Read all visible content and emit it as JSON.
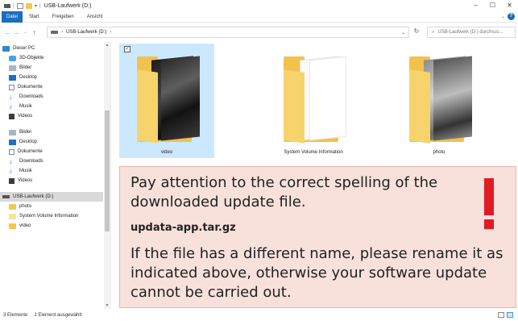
{
  "window": {
    "title": "USB-Laufwerk (D:)",
    "controls": {
      "minimize": "–",
      "maximize": "☐",
      "close": "✕"
    }
  },
  "ribbon": {
    "tabs": [
      "Datei",
      "Start",
      "Freigeben",
      "Ansicht"
    ],
    "help": "?"
  },
  "address": {
    "path": "USB-Laufwerk (D:)",
    "search_placeholder": "USB-Laufwerk (D:) durchsuc..."
  },
  "sidebar": {
    "items": [
      {
        "label": "Dieser PC",
        "icon": "pc-icon"
      },
      {
        "label": "3D-Objekte",
        "icon": "3d-objects-icon"
      },
      {
        "label": "Bilder",
        "icon": "pictures-icon"
      },
      {
        "label": "Desktop",
        "icon": "desktop-icon"
      },
      {
        "label": "Dokumente",
        "icon": "documents-icon"
      },
      {
        "label": "Downloads",
        "icon": "download-icon"
      },
      {
        "label": "Musik",
        "icon": "music-icon"
      },
      {
        "label": "Videos",
        "icon": "video-icon"
      },
      {
        "label": "Bilder",
        "icon": "pictures-icon"
      },
      {
        "label": "Desktop",
        "icon": "desktop-icon"
      },
      {
        "label": "Dokumente",
        "icon": "documents-icon"
      },
      {
        "label": "Downloads",
        "icon": "download-icon"
      },
      {
        "label": "Musik",
        "icon": "music-icon"
      },
      {
        "label": "Videos",
        "icon": "video-icon"
      },
      {
        "label": "USB-Laufwerk (D:)",
        "icon": "usb-drive-icon",
        "selected": true
      },
      {
        "label": "photo",
        "icon": "folder-icon"
      },
      {
        "label": "System Volume Information",
        "icon": "folder-icon"
      },
      {
        "label": "video",
        "icon": "folder-icon"
      }
    ]
  },
  "main": {
    "items": [
      {
        "label": "video",
        "selected": true
      },
      {
        "label": "System Volume Information",
        "selected": false
      },
      {
        "label": "photo",
        "selected": false
      }
    ]
  },
  "notice": {
    "message": "Pay attention to the correct spelling of the downloaded update file.",
    "filename": "updata-app.tar.gz",
    "instruction": "If the file has a different name, please rename it as indicated above, otherwise your software update cannot be carried out.",
    "accent_color": "#e01b24",
    "background": "#f8e1db"
  },
  "status": {
    "item_count": "3 Elemente",
    "selection": "1 Element ausgewählt"
  },
  "colors": {
    "accent": "#1a6dbf",
    "selection": "#cce8ff",
    "folder": "#f2c14e"
  }
}
